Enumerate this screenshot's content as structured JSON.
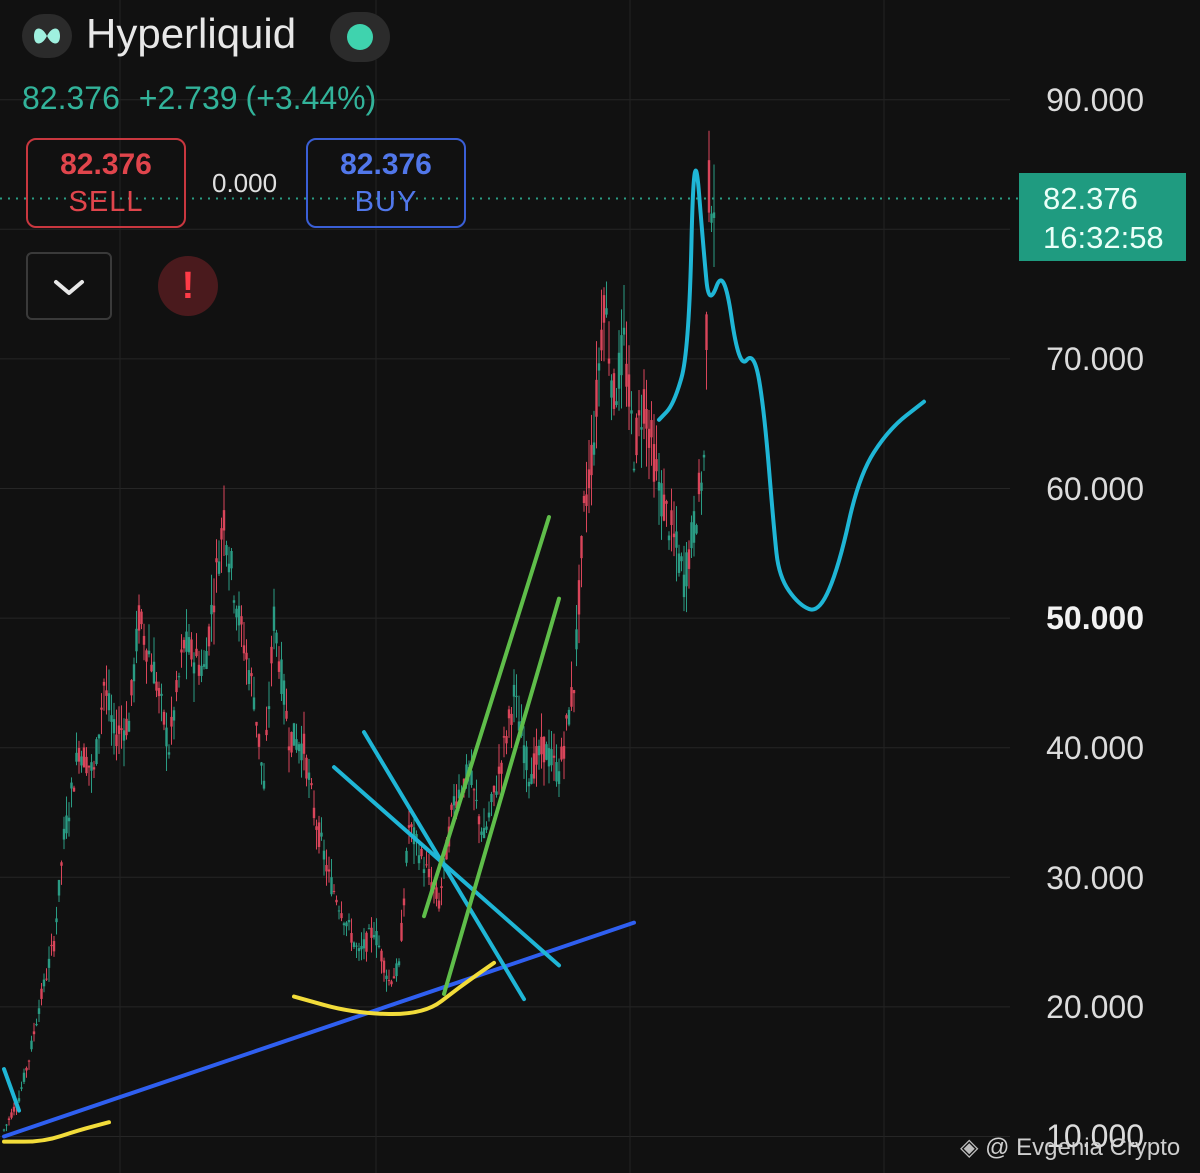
{
  "header": {
    "title": "Hyperliquid",
    "logo_icon": "hyperliquid-logo-icon",
    "status_icon": "live-dot-icon"
  },
  "quote": {
    "last": "82.376",
    "change": "+2.739",
    "change_pct": "(+3.44%)"
  },
  "order": {
    "sell_price": "82.376",
    "sell_label": "SELL",
    "spread": "0.000",
    "buy_price": "82.376",
    "buy_label": "BUY"
  },
  "controls": {
    "dropdown_icon": "chevron-down-icon",
    "alert_icon": "alert-icon",
    "alert_glyph": "!"
  },
  "price_tag": {
    "price": "82.376",
    "countdown": "16:32:58"
  },
  "watermark": {
    "text": "@ Evgenia Crypto",
    "icon": "binance-logo-icon"
  },
  "colors": {
    "background": "#111111",
    "up": "#2a9c84",
    "down": "#d9455a",
    "sell": "#e0454c",
    "buy": "#5177ea",
    "tag": "#1f9b80",
    "drawing_cyan": "#1fb6d6",
    "drawing_green": "#5fbe4a",
    "drawing_blue": "#2f5ff0",
    "drawing_yellow": "#f2dc3a"
  },
  "chart_data": {
    "type": "candlestick",
    "symbol": "Hyperliquid",
    "y_axis_labels": [
      "90.000",
      "70.000",
      "60.000",
      "50.000",
      "40.000",
      "30.000",
      "20.000",
      "10.000"
    ],
    "ylim": [
      9.5,
      92
    ],
    "current_price": 82.376,
    "grid": true,
    "price_path": [
      [
        0,
        10.5
      ],
      [
        3,
        13
      ],
      [
        5,
        16
      ],
      [
        7,
        20
      ],
      [
        10,
        25
      ],
      [
        12,
        33
      ],
      [
        15,
        40
      ],
      [
        18,
        38
      ],
      [
        20,
        45
      ],
      [
        22,
        41
      ],
      [
        25,
        42
      ],
      [
        27,
        50
      ],
      [
        30,
        46
      ],
      [
        33,
        40
      ],
      [
        36,
        48
      ],
      [
        40,
        46
      ],
      [
        42,
        52
      ],
      [
        44,
        58
      ],
      [
        45,
        55
      ],
      [
        47,
        50
      ],
      [
        50,
        44
      ],
      [
        52,
        37
      ],
      [
        54,
        50
      ],
      [
        57,
        41
      ],
      [
        60,
        40
      ],
      [
        62,
        35
      ],
      [
        65,
        30
      ],
      [
        68,
        27
      ],
      [
        71,
        24
      ],
      [
        74,
        26
      ],
      [
        77,
        22
      ],
      [
        79,
        23
      ],
      [
        81,
        34
      ],
      [
        84,
        31
      ],
      [
        87,
        28
      ],
      [
        90,
        36
      ],
      [
        93,
        38
      ],
      [
        96,
        33
      ],
      [
        99,
        38
      ],
      [
        102,
        44
      ],
      [
        105,
        38
      ],
      [
        108,
        40
      ],
      [
        111,
        38
      ],
      [
        114,
        45
      ],
      [
        116,
        58
      ],
      [
        118,
        64
      ],
      [
        120,
        75
      ],
      [
        122,
        67
      ],
      [
        124,
        71
      ],
      [
        126,
        63
      ],
      [
        128,
        67
      ],
      [
        131,
        60
      ],
      [
        134,
        56
      ],
      [
        136,
        53
      ],
      [
        138,
        57
      ],
      [
        140,
        62
      ],
      [
        141,
        83
      ],
      [
        142,
        82.4
      ]
    ],
    "drawings": [
      {
        "type": "trendline",
        "color": "blue",
        "from": [
          0,
          10.0
        ],
        "to": [
          126,
          26.5
        ]
      },
      {
        "type": "line",
        "color": "cyan",
        "from": [
          66,
          38.5
        ],
        "to": [
          111,
          23.2
        ]
      },
      {
        "type": "line",
        "color": "cyan",
        "from": [
          72,
          41.2
        ],
        "to": [
          104,
          20.6
        ]
      },
      {
        "type": "line",
        "color": "green",
        "from": [
          84,
          27.0
        ],
        "to": [
          109,
          57.8
        ]
      },
      {
        "type": "line",
        "color": "green",
        "from": [
          88,
          21.0
        ],
        "to": [
          111,
          51.5
        ]
      },
      {
        "type": "curve",
        "color": "yellow",
        "points": [
          [
            58,
            20.8
          ],
          [
            70,
            19.5
          ],
          [
            84,
            19.4
          ],
          [
            91,
            21.5
          ],
          [
            98,
            23.4
          ]
        ]
      },
      {
        "type": "curve",
        "color": "yellow",
        "points": [
          [
            0,
            9.6
          ],
          [
            8,
            9.6
          ],
          [
            15,
            10.5
          ],
          [
            21,
            11.1
          ]
        ]
      },
      {
        "type": "line",
        "color": "cyan",
        "from": [
          0,
          15.2
        ],
        "to": [
          3,
          12.0
        ]
      },
      {
        "type": "projection",
        "color": "cyan",
        "points": [
          [
            131,
            65.3
          ],
          [
            134,
            66.5
          ],
          [
            137,
            70.6
          ],
          [
            138,
            87.6
          ],
          [
            140,
            78.0
          ],
          [
            141,
            74.0
          ],
          [
            144,
            77.2
          ],
          [
            147,
            69.2
          ],
          [
            150,
            70.6
          ],
          [
            152,
            66.2
          ],
          [
            154,
            56.8
          ],
          [
            155,
            53.2
          ],
          [
            159,
            51.0
          ],
          [
            163,
            50.4
          ],
          [
            167,
            54.0
          ],
          [
            171,
            61.0
          ],
          [
            177,
            64.6
          ],
          [
            184,
            66.7
          ]
        ]
      }
    ]
  }
}
